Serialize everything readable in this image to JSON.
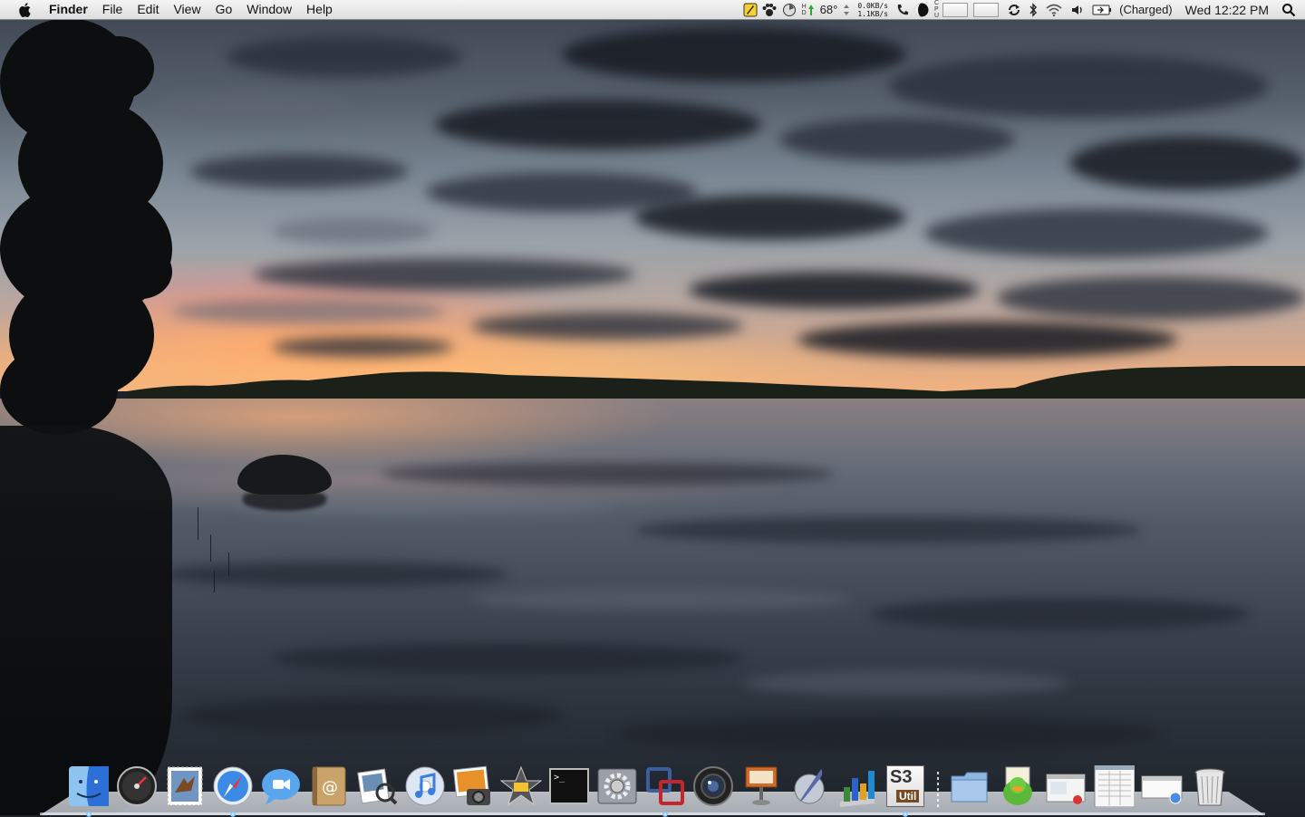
{
  "menubar": {
    "apple_icon": "apple-logo-icon",
    "app_name": "Finder",
    "menus": [
      "File",
      "Edit",
      "View",
      "Go",
      "Window",
      "Help"
    ],
    "status": {
      "temperature": "68°",
      "net_down": "0.0KB/s",
      "net_up": "1.1KB/s",
      "battery": "(Charged)",
      "clock": "Wed 12:22 PM"
    }
  },
  "dock": {
    "apps": [
      {
        "name": "Finder",
        "icon": "finder-icon",
        "running": true
      },
      {
        "name": "Dashboard",
        "icon": "dashboard-icon",
        "running": false
      },
      {
        "name": "Mail",
        "icon": "mail-stamp-icon",
        "running": false
      },
      {
        "name": "Safari",
        "icon": "safari-compass-icon",
        "running": true
      },
      {
        "name": "iChat",
        "icon": "ichat-bubble-icon",
        "running": false
      },
      {
        "name": "Address Book",
        "icon": "address-book-icon",
        "running": false
      },
      {
        "name": "Preview",
        "icon": "preview-icon",
        "running": false
      },
      {
        "name": "iTunes",
        "icon": "itunes-note-icon",
        "running": false
      },
      {
        "name": "iPhoto",
        "icon": "iphoto-icon",
        "running": false
      },
      {
        "name": "iMovie",
        "icon": "imovie-star-icon",
        "running": false
      },
      {
        "name": "Terminal",
        "icon": "terminal-icon",
        "running": false
      },
      {
        "name": "System Preferences",
        "icon": "gear-icon",
        "running": false
      },
      {
        "name": "VMware Fusion",
        "icon": "vmware-icon",
        "running": true
      },
      {
        "name": "Aperture",
        "icon": "camera-lens-icon",
        "running": false
      },
      {
        "name": "Keynote",
        "icon": "keynote-podium-icon",
        "running": false
      },
      {
        "name": "Script Editor",
        "icon": "quill-icon",
        "running": false
      },
      {
        "name": "Numbers",
        "icon": "bar-chart-icon",
        "running": false
      },
      {
        "name": "S3 Util",
        "icon": "s3-util-icon",
        "running": true
      }
    ],
    "s3_label": "S3",
    "s3_sub": "Util",
    "terminal_prompt": ">_",
    "docs": [
      {
        "name": "Applications",
        "icon": "folder-icon"
      },
      {
        "name": "Adium",
        "icon": "duck-icon"
      },
      {
        "name": "Screenshot",
        "icon": "window-stack-icon"
      },
      {
        "name": "Document",
        "icon": "spreadsheet-doc-icon"
      },
      {
        "name": "Network",
        "icon": "browser-window-icon"
      },
      {
        "name": "Trash",
        "icon": "trash-icon"
      }
    ]
  }
}
